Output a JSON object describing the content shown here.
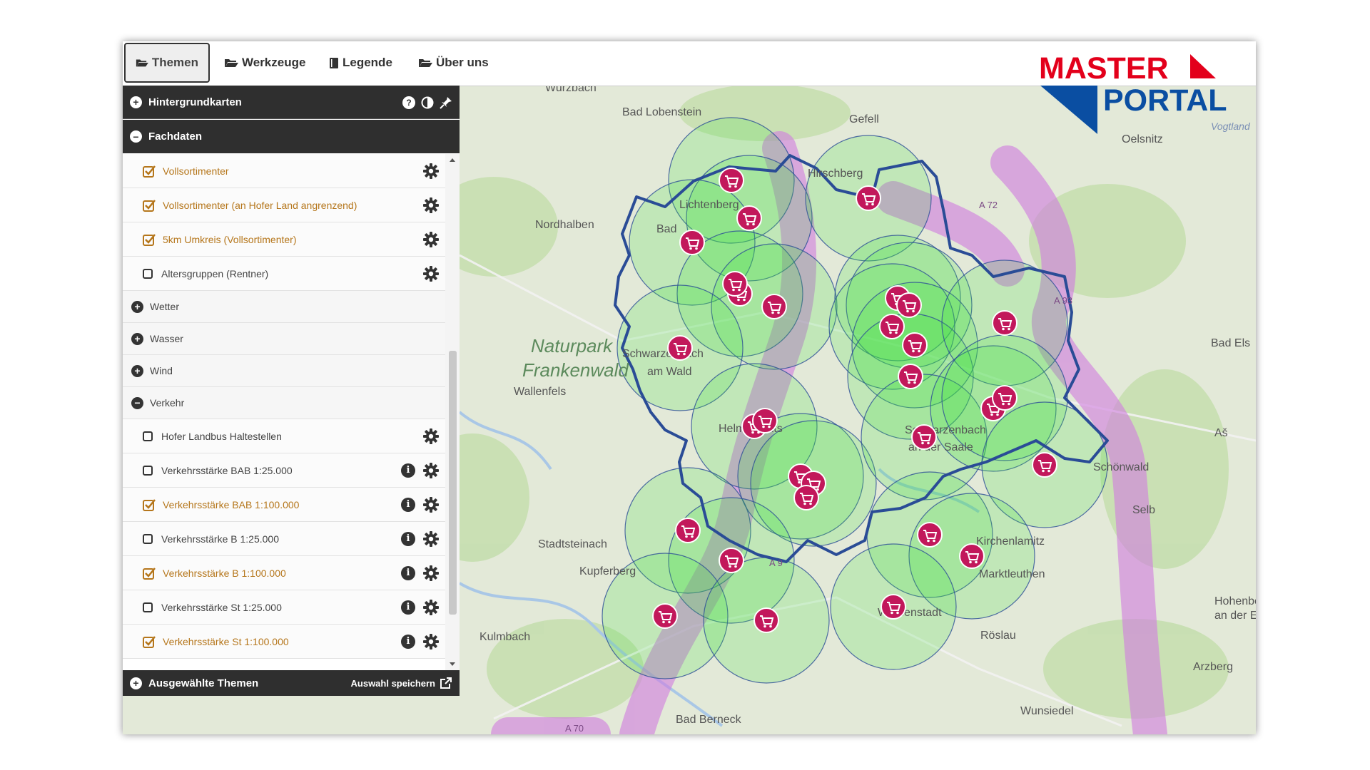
{
  "tabs": [
    {
      "label": "Themen",
      "active": true,
      "icon": "folder-open-icon"
    },
    {
      "label": "Werkzeuge",
      "active": false,
      "icon": "folder-open-icon"
    },
    {
      "label": "Legende",
      "active": false,
      "icon": "book-icon"
    },
    {
      "label": "Über uns",
      "active": false,
      "icon": "folder-open-icon"
    }
  ],
  "logo": {
    "line1": "MASTER",
    "line2": "PORTAL"
  },
  "panel": {
    "hintergrund": {
      "label": "Hintergrundkarten",
      "icons": [
        "help-icon",
        "contrast-icon",
        "pin-icon"
      ]
    },
    "fachdaten": {
      "label": "Fachdaten"
    },
    "layers": [
      {
        "label": "Vollsortimenter",
        "checked": true,
        "info": false
      },
      {
        "label": "Vollsortimenter (an Hofer Land angrenzend)",
        "checked": true,
        "info": false
      },
      {
        "label": "5km Umkreis (Vollsortimenter)",
        "checked": true,
        "info": false
      },
      {
        "label": "Altersgruppen (Rentner)",
        "checked": false,
        "info": false
      }
    ],
    "folders": [
      {
        "label": "Wetter",
        "expanded": false
      },
      {
        "label": "Wasser",
        "expanded": false
      },
      {
        "label": "Wind",
        "expanded": false
      },
      {
        "label": "Verkehr",
        "expanded": true
      }
    ],
    "verkehr_layers": [
      {
        "label": "Hofer Landbus Haltestellen",
        "checked": false,
        "info": false
      },
      {
        "label": "Verkehrsstärke BAB 1:25.000",
        "checked": false,
        "info": true
      },
      {
        "label": "Verkehrsstärke BAB 1:100.000",
        "checked": true,
        "info": true
      },
      {
        "label": "Verkehrsstärke B 1:25.000",
        "checked": false,
        "info": true
      },
      {
        "label": "Verkehrsstärke B 1:100.000",
        "checked": true,
        "info": true
      },
      {
        "label": "Verkehrsstärke St 1:25.000",
        "checked": false,
        "info": true
      },
      {
        "label": "Verkehrsstärke St 1:100.000",
        "checked": true,
        "info": true
      }
    ],
    "footer": {
      "label": "Ausgewählte Themen",
      "save_label": "Auswahl speichern"
    }
  },
  "map_labels": [
    "Wurzbach",
    "Bad Lobenstein",
    "Gefell",
    "Oelsnitz",
    "Vogtland",
    "Hirschberg",
    "Lichtenberg",
    "Nordhalben",
    "Bad",
    "Naturpark",
    "Frankenwald",
    "Wallenfels",
    "Schwarzenbach",
    "am Wald",
    "Helmbrechts",
    "Schwarzenbach",
    "an der Saale",
    "Bad Els",
    "Schönwald",
    "Aš",
    "Selb",
    "Stadtsteinach",
    "Kupferberg",
    "Kirchenlamitz",
    "Marktleuthen",
    "Kulmbach",
    "Weißenstadt",
    "Röslau",
    "Hohenberg",
    "an der Eger",
    "Arzberg",
    "Wunsiedel",
    "Bad Berneck",
    "A 72",
    "A 93",
    "A 9",
    "A 70"
  ],
  "colors": {
    "accent": "#b5761b",
    "header": "#2f2f2f",
    "marker": "#c2185b",
    "buffer": "#3ce23c",
    "autobahn": "#d07be0",
    "border": "#2a4c96",
    "logo_red": "#e3001b",
    "logo_blue": "#0a4ea2"
  }
}
